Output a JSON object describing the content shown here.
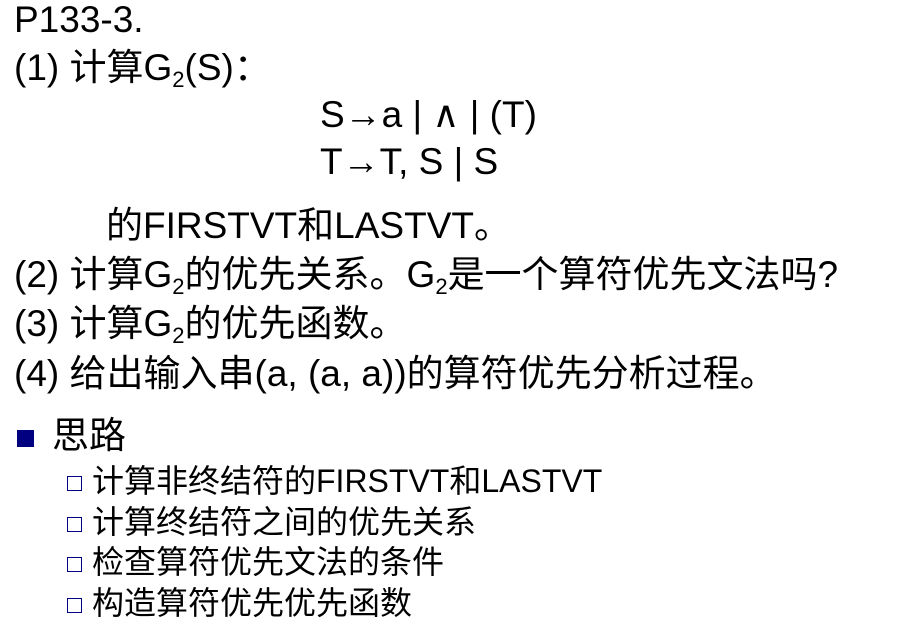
{
  "problem_id": "P133-3.",
  "items": {
    "q1_prefix": "(1) 计算G",
    "q1_sub": "2",
    "q1_suffix": "(S)：",
    "grammar_line1": "S→a | ∧ | (T)",
    "grammar_line2": "T→T, S | S",
    "q1_continuation": "的FIRSTVT和LASTVT。",
    "q2_prefix": "(2) 计算G",
    "q2_sub": "2",
    "q2_mid": "的优先关系。G",
    "q2_sub2": "2",
    "q2_suffix": "是一个算符优先文法吗?",
    "q3_prefix": "(3) 计算G",
    "q3_sub": "2",
    "q3_suffix": "的优先函数。",
    "q4": "(4) 给出输入串(a, (a, a))的算符优先分析过程。"
  },
  "approach": {
    "heading": "思路",
    "steps": [
      "计算非终结符的FIRSTVT和LASTVT",
      "计算终结符之间的优先关系",
      "检查算符优先文法的条件",
      "构造算符优先优先函数"
    ]
  },
  "colors": {
    "bullet": "#000080",
    "text": "#000000",
    "background": "#ffffff"
  }
}
